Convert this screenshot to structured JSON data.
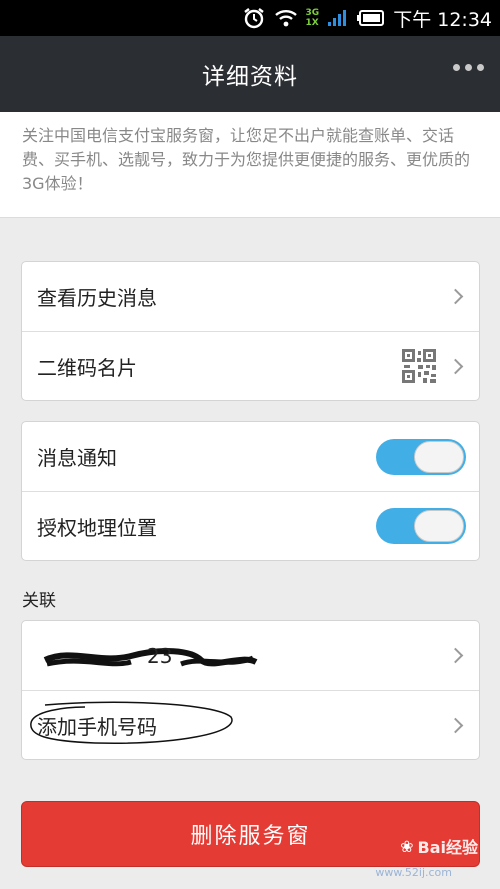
{
  "status_bar": {
    "network_top": "3G",
    "network_bottom": "1X",
    "time": "下午 12:34"
  },
  "header": {
    "title": "详细资料",
    "more_icon": "more-dots-icon"
  },
  "description": "关注中国电信支付宝服务窗，让您足不出户就能查账单、交话费、买手机、选靓号，致力于为您提供更便捷的服务、更优质的3G体验！",
  "group1": {
    "items": [
      {
        "label": "查看历史消息"
      },
      {
        "label": "二维码名片"
      }
    ]
  },
  "group2": {
    "items": [
      {
        "label": "消息通知",
        "enabled": true
      },
      {
        "label": "授权地理位置",
        "enabled": true
      }
    ]
  },
  "related": {
    "section_label": "关联",
    "items": [
      {
        "label": "23"
      },
      {
        "label": "添加手机号码"
      }
    ]
  },
  "delete_button": "删除服务窗",
  "watermark": {
    "text": "Bai经验",
    "url": "www.52ij.com"
  },
  "colors": {
    "header_bg": "#2b2e33",
    "toggle_on": "#41aee5",
    "delete_red": "#e43b34"
  }
}
